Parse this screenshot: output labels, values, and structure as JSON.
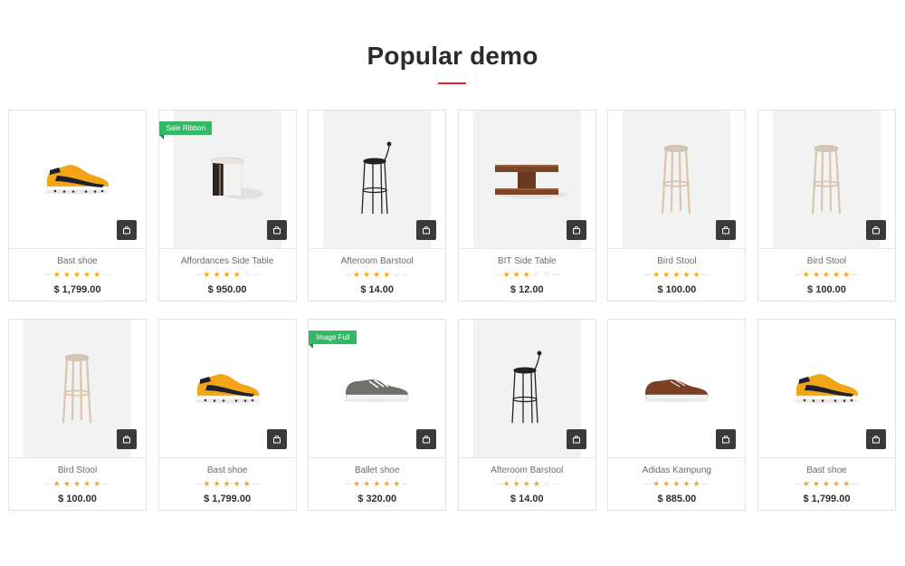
{
  "section": {
    "title": "Popular demo",
    "accent_color": "#e8232a"
  },
  "colors": {
    "star": "#f5a623",
    "star_empty": "#c9c9c9",
    "ribbon": "#33b866",
    "cart_button": "#3a3a3a"
  },
  "products": [
    {
      "name": "Bast shoe",
      "rating": 5,
      "price": "$ 1,799.00",
      "image": "yellow-sneaker",
      "bg": "white",
      "ribbon": ""
    },
    {
      "name": "Affordances Side Table",
      "rating": 4,
      "price": "$ 950.00",
      "image": "round-side-table",
      "bg": "gray",
      "ribbon": "Sale Ribbon"
    },
    {
      "name": "Afteroom Barstool",
      "rating": 4,
      "price": "$ 14.00",
      "image": "black-barstool",
      "bg": "gray",
      "ribbon": ""
    },
    {
      "name": "BIT Side Table",
      "rating": 3,
      "price": "$ 12.00",
      "image": "wood-side-table",
      "bg": "gray",
      "ribbon": ""
    },
    {
      "name": "Bird Stool",
      "rating": 5,
      "price": "$ 100.00",
      "image": "wood-stool",
      "bg": "gray",
      "ribbon": ""
    },
    {
      "name": "Bird Stool",
      "rating": 5,
      "price": "$ 100.00",
      "image": "wood-stool",
      "bg": "gray",
      "ribbon": ""
    },
    {
      "name": "Bird Stool",
      "rating": 5,
      "price": "$ 100.00",
      "image": "wood-stool",
      "bg": "gray",
      "ribbon": ""
    },
    {
      "name": "Bast shoe",
      "rating": 5,
      "price": "$ 1,799.00",
      "image": "yellow-sneaker",
      "bg": "white",
      "ribbon": ""
    },
    {
      "name": "Ballet shoe",
      "rating": 5,
      "price": "$ 320.00",
      "image": "gray-sneaker",
      "bg": "white",
      "ribbon": "Image Full"
    },
    {
      "name": "Afteroom Barstool",
      "rating": 4,
      "price": "$ 14.00",
      "image": "black-barstool",
      "bg": "gray",
      "ribbon": ""
    },
    {
      "name": "Adidas Kampung",
      "rating": 5,
      "price": "$ 885.00",
      "image": "brown-shoe",
      "bg": "white",
      "ribbon": ""
    },
    {
      "name": "Bast shoe",
      "rating": 5,
      "price": "$ 1,799.00",
      "image": "yellow-sneaker",
      "bg": "white",
      "ribbon": ""
    }
  ]
}
